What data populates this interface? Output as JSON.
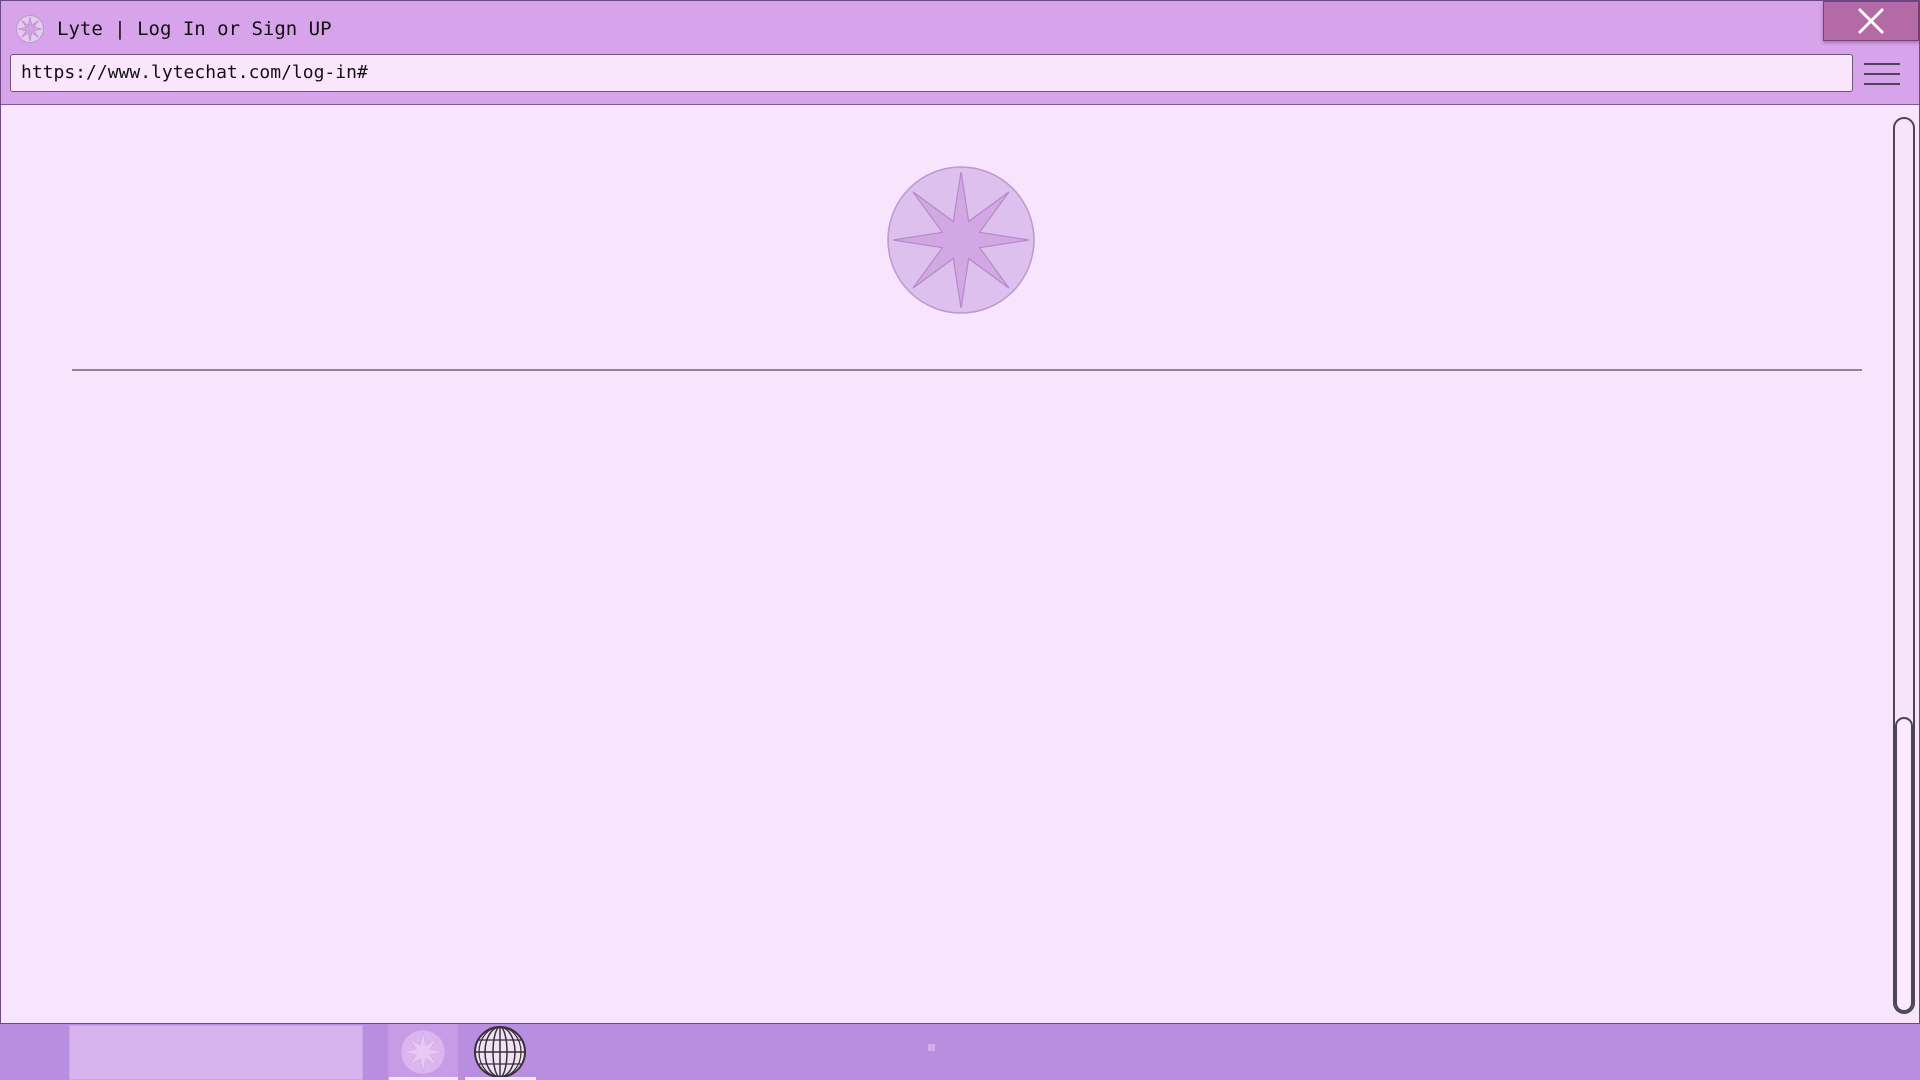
{
  "window": {
    "title": "Lyte | Log In or Sign UP",
    "close_icon": "close-icon",
    "tab_icon": "lyte-star-icon"
  },
  "toolbar": {
    "url": "https://www.lytechat.com/log-in#",
    "menu_icon": "hamburger-menu-icon"
  },
  "page": {
    "logo_icon": "lyte-star-logo"
  },
  "taskbar": {
    "search_value": "",
    "apps": [
      {
        "name": "Lyte",
        "icon": "lyte-star-icon",
        "active": true
      },
      {
        "name": "Browser",
        "icon": "globe-icon",
        "active": true
      }
    ]
  },
  "colors": {
    "titlebar": "#d7a3ea",
    "page_background": "#f8e4fd",
    "close_button": "#b36aa6",
    "taskbar": "#b98de0",
    "logo_fill": "#ddc0ee",
    "logo_star": "#d2a7e3"
  }
}
